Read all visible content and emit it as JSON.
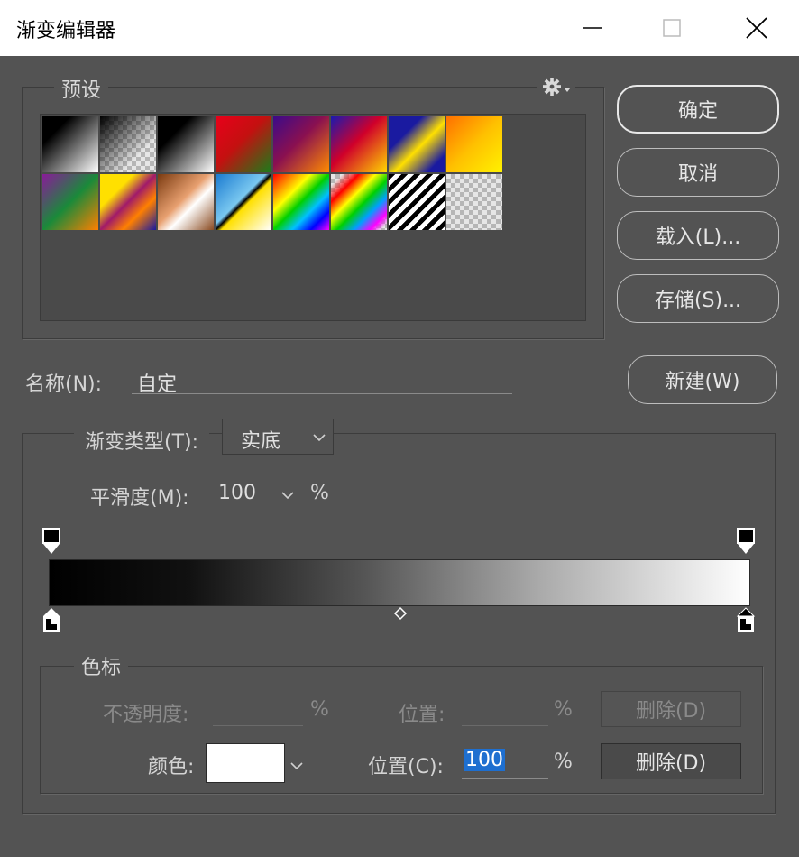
{
  "window": {
    "title": "渐变编辑器",
    "minimize": "minimize-icon",
    "maximize": "maximize-icon",
    "close": "close-icon"
  },
  "presets": {
    "legend": "预设",
    "gear": "gear-icon"
  },
  "buttons": {
    "ok": "确定",
    "cancel": "取消",
    "load": "载入(L)...",
    "save": "存储(S)...",
    "new": "新建(W)"
  },
  "name": {
    "label": "名称(N):",
    "value": "自定"
  },
  "gradient": {
    "type_label": "渐变类型(T):",
    "type_value": "实底",
    "smooth_label": "平滑度(M):",
    "smooth_value": "100",
    "smooth_unit": "%"
  },
  "stops": {
    "legend": "色标",
    "opacity_label": "不透明度:",
    "opacity_unit": "%",
    "opacity_location_label": "位置:",
    "opacity_location_unit": "%",
    "opacity_delete": "删除(D)",
    "color_label": "颜色:",
    "color_value": "#ffffff",
    "color_location_label": "位置(C):",
    "color_location_value": "100",
    "color_location_unit": "%",
    "color_delete": "删除(D)"
  },
  "colors": {
    "background": "#535353",
    "title_bar": "#ffffff",
    "selection": "#1e6fd0"
  }
}
